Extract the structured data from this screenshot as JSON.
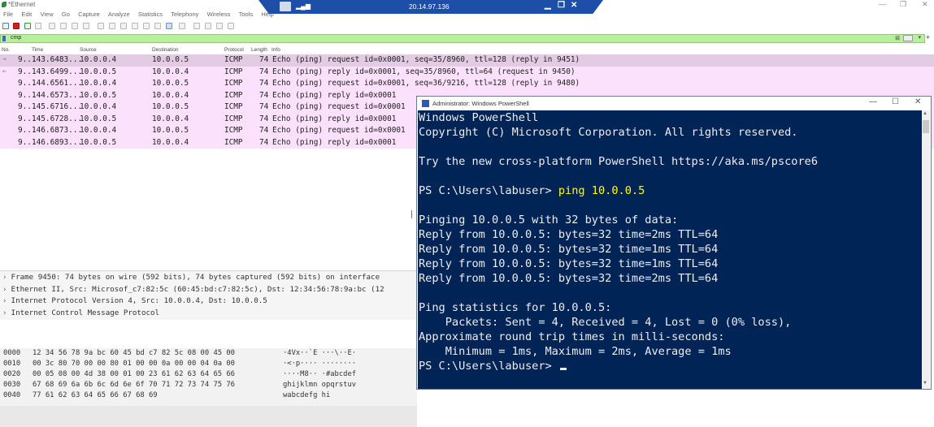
{
  "wireshark": {
    "title": "*Ethernet",
    "menu": [
      "File",
      "Edit",
      "View",
      "Go",
      "Capture",
      "Analyze",
      "Statistics",
      "Telephony",
      "Wireless",
      "Tools",
      "Help"
    ],
    "filter_text": "cmp",
    "filter_clear": "⊠",
    "filter_dropdown": "▾",
    "add_filter": "+",
    "columns": [
      "No.",
      "Time",
      "Source",
      "Destination",
      "Protocol",
      "Length",
      "Info"
    ],
    "packets": [
      {
        "no": "9...",
        "time": "143.6483...",
        "src": "10.0.0.4",
        "dst": "10.0.0.5",
        "proto": "ICMP",
        "len": "74",
        "info": "Echo (ping) request  id=0x0001, seq=35/8960, ttl=128 (reply in 9451)"
      },
      {
        "no": "9...",
        "time": "143.6499...",
        "src": "10.0.0.5",
        "dst": "10.0.0.4",
        "proto": "ICMP",
        "len": "74",
        "info": "Echo (ping) reply    id=0x0001, seq=35/8960, ttl=64 (request in 9450)"
      },
      {
        "no": "9...",
        "time": "144.6561...",
        "src": "10.0.0.4",
        "dst": "10.0.0.5",
        "proto": "ICMP",
        "len": "74",
        "info": "Echo (ping) request  id=0x0001, seq=36/9216, ttl=128 (reply in 9480)"
      },
      {
        "no": "9...",
        "time": "144.6573...",
        "src": "10.0.0.5",
        "dst": "10.0.0.4",
        "proto": "ICMP",
        "len": "74",
        "info": "Echo (ping) reply    id=0x0001"
      },
      {
        "no": "9...",
        "time": "145.6716...",
        "src": "10.0.0.4",
        "dst": "10.0.0.5",
        "proto": "ICMP",
        "len": "74",
        "info": "Echo (ping) request  id=0x0001"
      },
      {
        "no": "9...",
        "time": "145.6728...",
        "src": "10.0.0.5",
        "dst": "10.0.0.4",
        "proto": "ICMP",
        "len": "74",
        "info": "Echo (ping) reply    id=0x0001"
      },
      {
        "no": "9...",
        "time": "146.6873...",
        "src": "10.0.0.4",
        "dst": "10.0.0.5",
        "proto": "ICMP",
        "len": "74",
        "info": "Echo (ping) request  id=0x0001"
      },
      {
        "no": "9...",
        "time": "146.6893...",
        "src": "10.0.0.5",
        "dst": "10.0.0.4",
        "proto": "ICMP",
        "len": "74",
        "info": "Echo (ping) reply    id=0x0001"
      }
    ],
    "details": [
      "Frame 9450: 74 bytes on wire (592 bits), 74 bytes captured (592 bits) on interface",
      "Ethernet II, Src: Microsof_c7:82:5c (60:45:bd:c7:82:5c), Dst: 12:34:56:78:9a:bc (12",
      "Internet Protocol Version 4, Src: 10.0.0.4, Dst: 10.0.0.5",
      "Internet Control Message Protocol"
    ],
    "hex": [
      {
        "off": "0000",
        "bytes": "12 34 56 78 9a bc 60 45  bd c7 82 5c 08 00 45 00",
        "ascii": "·4Vx··`E ···\\··E·"
      },
      {
        "off": "0010",
        "bytes": "00 3c 80 70 00 00 80 01  00 00 0a 00 00 04 0a 00",
        "ascii": "·<·p···· ········"
      },
      {
        "off": "0020",
        "bytes": "00 05 08 00 4d 38 00 01  00 23 61 62 63 64 65 66",
        "ascii": "····M8·· ·#abcdef"
      },
      {
        "off": "0030",
        "bytes": "67 68 69 6a 6b 6c 6d 6e  6f 70 71 72 73 74 75 76",
        "ascii": "ghijklmn opqrstuv"
      },
      {
        "off": "0040",
        "bytes": "77 61 62 63 64 65 66 67  68 69",
        "ascii": "wabcdefg hi"
      }
    ]
  },
  "rdp": {
    "host": "20.14.97.136",
    "minimize": "▁",
    "restore": "❐",
    "close": "✕"
  },
  "powershell": {
    "title": "Administrator: Windows PowerShell",
    "minimize": "—",
    "maximize": "☐",
    "close": "✕",
    "lines": {
      "l1": "Windows PowerShell",
      "l2": "Copyright (C) Microsoft Corporation. All rights reserved.",
      "l3": "Try the new cross-platform PowerShell https://aka.ms/pscore6",
      "prompt1": "PS C:\\Users\\labuser> ",
      "cmd": "ping 10.0.0.5",
      "l5": "Pinging 10.0.0.5 with 32 bytes of data:",
      "r1": "Reply from 10.0.0.5: bytes=32 time=2ms TTL=64",
      "r2": "Reply from 10.0.0.5: bytes=32 time=1ms TTL=64",
      "r3": "Reply from 10.0.0.5: bytes=32 time=1ms TTL=64",
      "r4": "Reply from 10.0.0.5: bytes=32 time=2ms TTL=64",
      "s1": "Ping statistics for 10.0.0.5:",
      "s2": "    Packets: Sent = 4, Received = 4, Lost = 0 (0% loss),",
      "s3": "Approximate round trip times in milli-seconds:",
      "s4": "    Minimum = 1ms, Maximum = 2ms, Average = 1ms",
      "prompt2": "PS C:\\Users\\labuser> "
    }
  }
}
